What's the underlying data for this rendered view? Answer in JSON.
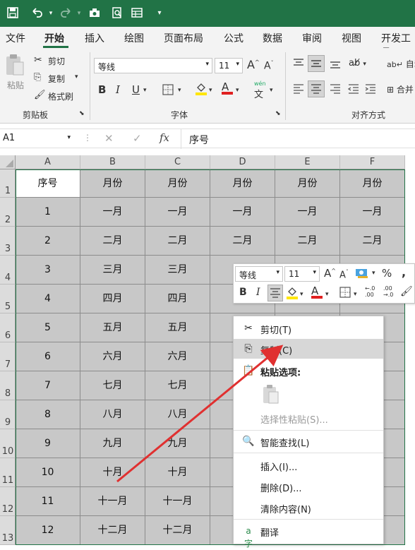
{
  "quick_access": {
    "icons": [
      "save-icon",
      "undo-icon",
      "redo-icon",
      "camera-icon",
      "print-preview-icon",
      "form-icon",
      "customize-icon"
    ]
  },
  "menu": {
    "tabs": [
      "文件",
      "开始",
      "插入",
      "绘图",
      "页面布局",
      "公式",
      "数据",
      "审阅",
      "视图",
      "开发工具"
    ],
    "active": "开始"
  },
  "ribbon": {
    "clipboard": {
      "paste": "粘贴",
      "cut": "剪切",
      "copy": "复制",
      "format_painter": "格式刷",
      "group_label": "剪贴板"
    },
    "font": {
      "font_name": "等线",
      "font_size": "11",
      "bold": "B",
      "italic": "I",
      "underline": "U",
      "grow": "A",
      "shrink": "A",
      "phonetic": "wén",
      "phonetic_char": "文",
      "font_color": "A",
      "group_label": "字体"
    },
    "alignment": {
      "wrap": "自动",
      "merge": "合并",
      "group_label": "对齐方式"
    }
  },
  "formula_bar": {
    "name_box": "A1",
    "fx": "fx",
    "content": "序号"
  },
  "columns": [
    "A",
    "B",
    "C",
    "D",
    "E",
    "F"
  ],
  "rows": [
    {
      "n": "1",
      "cells": [
        "序号",
        "月份",
        "月份",
        "月份",
        "月份",
        "月份"
      ]
    },
    {
      "n": "2",
      "cells": [
        "1",
        "一月",
        "一月",
        "一月",
        "一月",
        "一月"
      ]
    },
    {
      "n": "3",
      "cells": [
        "2",
        "二月",
        "二月",
        "二月",
        "二月",
        "二月"
      ]
    },
    {
      "n": "4",
      "cells": [
        "3",
        "三月",
        "三月",
        "",
        "",
        ""
      ]
    },
    {
      "n": "5",
      "cells": [
        "4",
        "四月",
        "四月",
        "",
        "",
        ""
      ]
    },
    {
      "n": "6",
      "cells": [
        "5",
        "五月",
        "五月",
        "",
        "",
        ""
      ]
    },
    {
      "n": "7",
      "cells": [
        "6",
        "六月",
        "六月",
        "",
        "",
        ""
      ]
    },
    {
      "n": "8",
      "cells": [
        "7",
        "七月",
        "七月",
        "",
        "",
        ""
      ]
    },
    {
      "n": "9",
      "cells": [
        "8",
        "八月",
        "八月",
        "",
        "",
        ""
      ]
    },
    {
      "n": "10",
      "cells": [
        "9",
        "九月",
        "九月",
        "",
        "",
        ""
      ]
    },
    {
      "n": "11",
      "cells": [
        "10",
        "十月",
        "十月",
        "",
        "",
        ""
      ]
    },
    {
      "n": "12",
      "cells": [
        "11",
        "十一月",
        "十一月",
        "",
        "",
        "月"
      ]
    },
    {
      "n": "13",
      "cells": [
        "12",
        "十二月",
        "十二月",
        "",
        "",
        "月"
      ]
    }
  ],
  "mini_toolbar": {
    "font_name": "等线",
    "font_size": "11",
    "percent": "%",
    "comma": ",",
    "inc_decimal": ".00→.0",
    "dec_decimal": ".0→.00"
  },
  "context_menu": {
    "cut": "剪切(T)",
    "copy": "复制(C)",
    "paste_options": "粘贴选项:",
    "paste_special": "选择性粘贴(S)...",
    "smart_lookup": "智能查找(L)",
    "insert": "插入(I)...",
    "delete": "删除(D)...",
    "clear": "清除内容(N)",
    "translate": "翻译"
  },
  "colors": {
    "excel_green": "#217346",
    "selection": "#c8c8c8",
    "arrow": "#e03030"
  }
}
